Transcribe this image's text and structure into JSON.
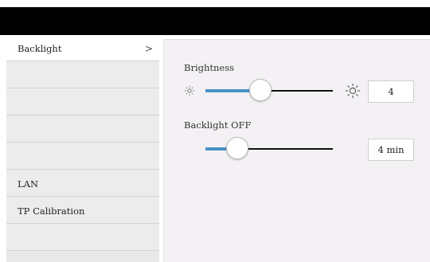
{
  "sidebar": {
    "items": [
      {
        "label": "Backlight",
        "chevron": ">",
        "active": true
      },
      {
        "label": ""
      },
      {
        "label": ""
      },
      {
        "label": ""
      },
      {
        "label": ""
      },
      {
        "label": "LAN"
      },
      {
        "label": "TP Calibration"
      },
      {
        "label": ""
      }
    ]
  },
  "brightness": {
    "title": "Brightness",
    "value": "4",
    "level": 0.43,
    "low_icon": "sun-dim-icon",
    "high_icon": "sun-bright-icon"
  },
  "backlight_off": {
    "title": "Backlight OFF",
    "value": "4 min",
    "level": 0.25
  },
  "colors": {
    "accent": "#4a90c8",
    "topbar": "#000000",
    "panel": "#f4f1f5"
  }
}
